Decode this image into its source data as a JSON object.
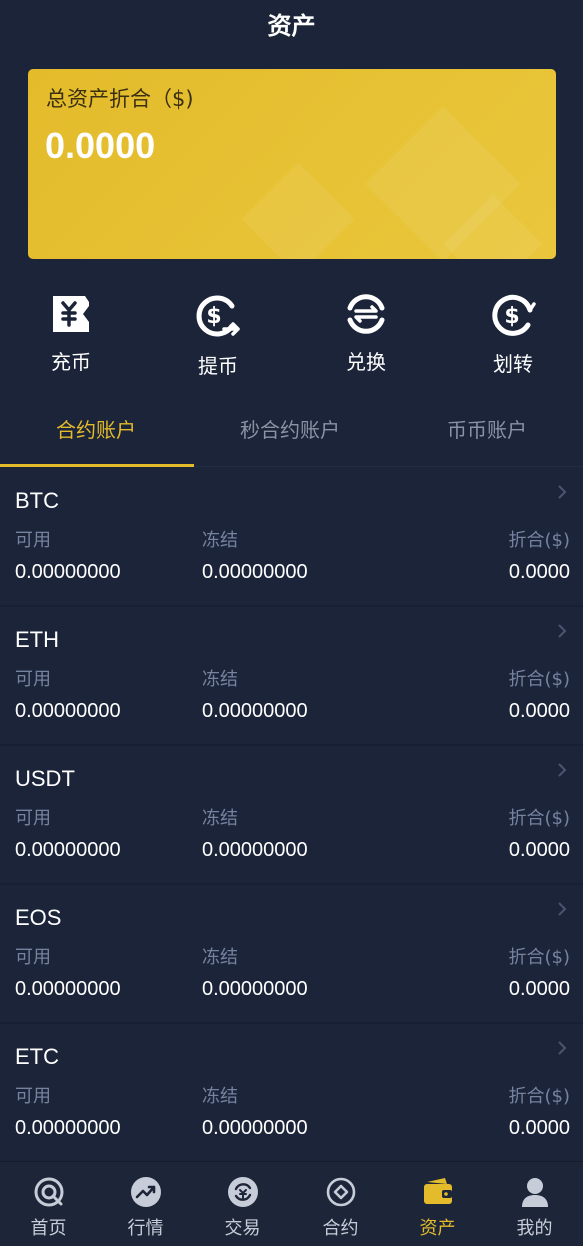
{
  "header": {
    "title": "资产"
  },
  "total": {
    "label": "总资产折合（$)",
    "value": "0.0000"
  },
  "actions": [
    {
      "label": "充币",
      "icon": "deposit-icon"
    },
    {
      "label": "提币",
      "icon": "withdraw-icon"
    },
    {
      "label": "兑换",
      "icon": "exchange-icon"
    },
    {
      "label": "划转",
      "icon": "transfer-icon"
    }
  ],
  "tabs": [
    {
      "label": "合约账户",
      "active": true
    },
    {
      "label": "秒合约账户",
      "active": false
    },
    {
      "label": "币币账户",
      "active": false
    }
  ],
  "columns": {
    "available": "可用",
    "frozen": "冻结",
    "converted": "折合($)"
  },
  "assets": [
    {
      "coin": "BTC",
      "available": "0.00000000",
      "frozen": "0.00000000",
      "converted": "0.0000"
    },
    {
      "coin": "ETH",
      "available": "0.00000000",
      "frozen": "0.00000000",
      "converted": "0.0000"
    },
    {
      "coin": "USDT",
      "available": "0.00000000",
      "frozen": "0.00000000",
      "converted": "0.0000"
    },
    {
      "coin": "EOS",
      "available": "0.00000000",
      "frozen": "0.00000000",
      "converted": "0.0000"
    },
    {
      "coin": "ETC",
      "available": "0.00000000",
      "frozen": "0.00000000",
      "converted": "0.0000"
    }
  ],
  "nav": [
    {
      "label": "首页",
      "icon": "home-icon",
      "active": false
    },
    {
      "label": "行情",
      "icon": "market-icon",
      "active": false
    },
    {
      "label": "交易",
      "icon": "trade-icon",
      "active": false
    },
    {
      "label": "合约",
      "icon": "contract-icon",
      "active": false
    },
    {
      "label": "资产",
      "icon": "wallet-icon",
      "active": true
    },
    {
      "label": "我的",
      "icon": "user-icon",
      "active": false
    }
  ],
  "colors": {
    "background": "#1b2438",
    "accent": "#e3bb2b",
    "muted": "#7683a0"
  }
}
